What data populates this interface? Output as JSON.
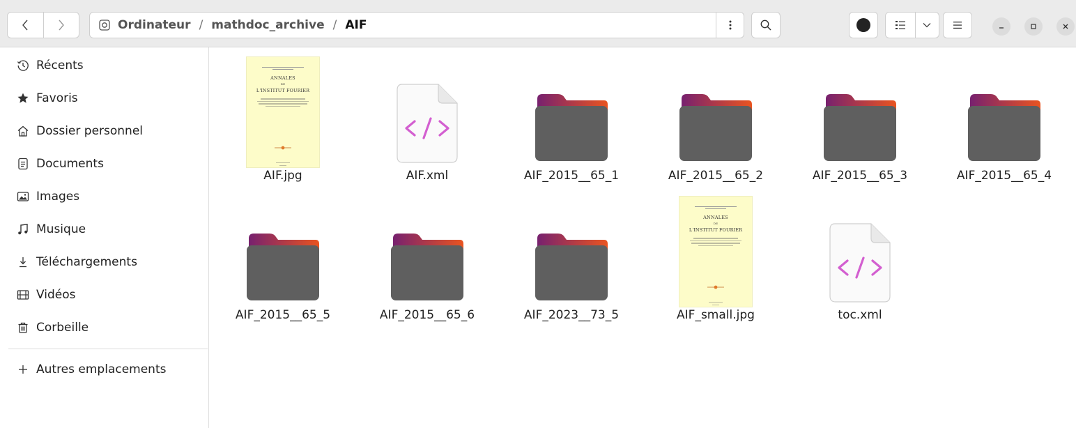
{
  "header": {
    "back_icon": "chevron-left-icon",
    "forward_icon": "chevron-right-icon",
    "path": [
      {
        "label": "Ordinateur",
        "icon": "drive-icon"
      },
      {
        "label": "mathdoc_archive"
      },
      {
        "label": "AIF"
      }
    ],
    "path_separator": "/",
    "menu_icon": "vertical-dots-icon",
    "search_icon": "search-icon",
    "record_icon": "filled-circle-icon",
    "view_list_icon": "list-view-icon",
    "view_dropdown_icon": "chevron-down-icon",
    "main_menu_icon": "hamburger-icon",
    "window_controls": [
      "minimize-icon",
      "maximize-icon",
      "close-icon"
    ]
  },
  "sidebar": {
    "items": [
      {
        "label": "Récents",
        "icon": "clock-icon"
      },
      {
        "label": "Favoris",
        "icon": "star-icon"
      },
      {
        "label": "Dossier personnel",
        "icon": "home-icon"
      },
      {
        "label": "Documents",
        "icon": "document-icon"
      },
      {
        "label": "Images",
        "icon": "image-icon"
      },
      {
        "label": "Musique",
        "icon": "music-note-icon"
      },
      {
        "label": "Téléchargements",
        "icon": "download-icon"
      },
      {
        "label": "Vidéos",
        "icon": "film-icon"
      },
      {
        "label": "Corbeille",
        "icon": "trash-icon"
      }
    ],
    "other": {
      "label": "Autres emplacements",
      "icon": "plus-icon"
    }
  },
  "files": [
    {
      "name": "AIF.jpg",
      "kind": "image"
    },
    {
      "name": "AIF.xml",
      "kind": "xml"
    },
    {
      "name": "AIF_2015__65_1",
      "kind": "folder"
    },
    {
      "name": "AIF_2015__65_2",
      "kind": "folder"
    },
    {
      "name": "AIF_2015__65_3",
      "kind": "folder"
    },
    {
      "name": "AIF_2015__65_4",
      "kind": "folder"
    },
    {
      "name": "AIF_2015__65_5",
      "kind": "folder"
    },
    {
      "name": "AIF_2015__65_6",
      "kind": "folder"
    },
    {
      "name": "AIF_2023__73_5",
      "kind": "folder"
    },
    {
      "name": "AIF_small.jpg",
      "kind": "image"
    },
    {
      "name": "toc.xml",
      "kind": "xml"
    }
  ],
  "cover": {
    "title": "ANNALES",
    "connector": "DE",
    "subtitle": "L'INSTITUT FOURIER"
  },
  "colors": {
    "accent_orange": "#e95420",
    "accent_aubergine": "#77216f",
    "folder_body": "#5f5f5f",
    "xml_code": "#d35fd0",
    "cover_bg": "#fdfcc9"
  }
}
